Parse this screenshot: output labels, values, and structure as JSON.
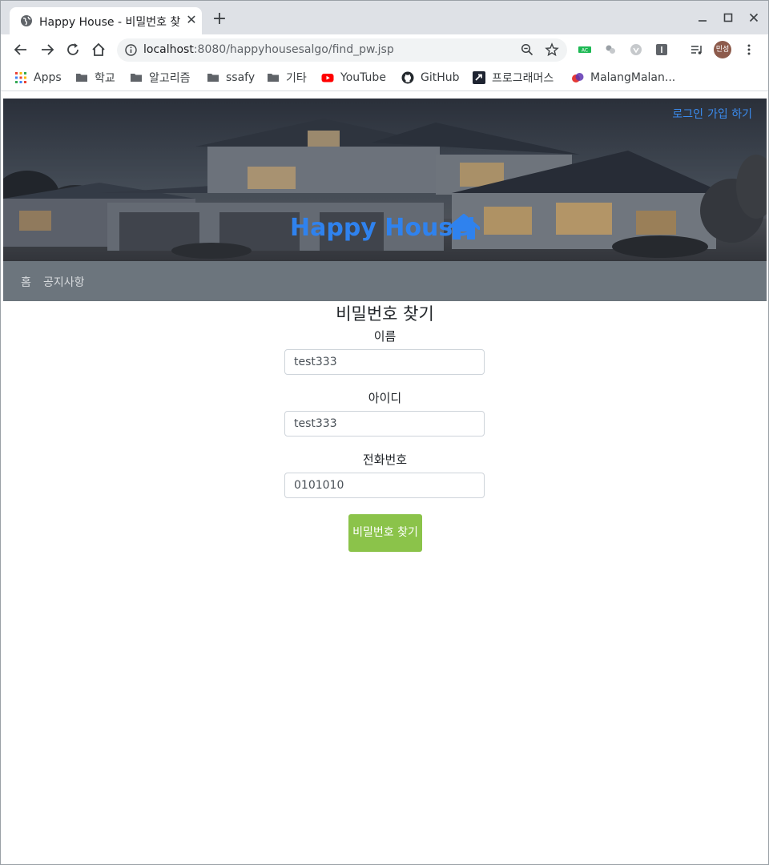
{
  "browser": {
    "tab_title": "Happy House - 비밀번호 찾기",
    "url_host": "localhost",
    "url_rest": ":8080/happyhousesalgo/find_pw.jsp",
    "profile_initials": "민성"
  },
  "bookmarks": [
    {
      "label": "Apps",
      "icon": "apps-grid-icon"
    },
    {
      "label": "학교",
      "icon": "folder-icon"
    },
    {
      "label": "알고리즘",
      "icon": "folder-icon"
    },
    {
      "label": "ssafy",
      "icon": "folder-icon"
    },
    {
      "label": "기타",
      "icon": "folder-icon"
    },
    {
      "label": "YouTube",
      "icon": "youtube-icon"
    },
    {
      "label": "GitHub",
      "icon": "github-icon"
    },
    {
      "label": "프로그래머스",
      "icon": "programmers-icon"
    },
    {
      "label": "MalangMalan...",
      "icon": "malang-icon"
    }
  ],
  "header": {
    "login_link": "로그인",
    "signup_link": "가입 하기",
    "brand": "Happy House",
    "brand_icon": "home-icon"
  },
  "nav": {
    "home": "홈",
    "notice": "공지사항"
  },
  "form": {
    "title": "비밀번호 찾기",
    "name_label": "이름",
    "name_value": "test333",
    "id_label": "아이디",
    "id_value": "test333",
    "phone_label": "전화번호",
    "phone_value": "0101010",
    "submit_label": "비밀번호 찾기"
  },
  "colors": {
    "brand": "#2f82ee",
    "navbar": "#6c757d",
    "submit": "#8bc34a"
  }
}
